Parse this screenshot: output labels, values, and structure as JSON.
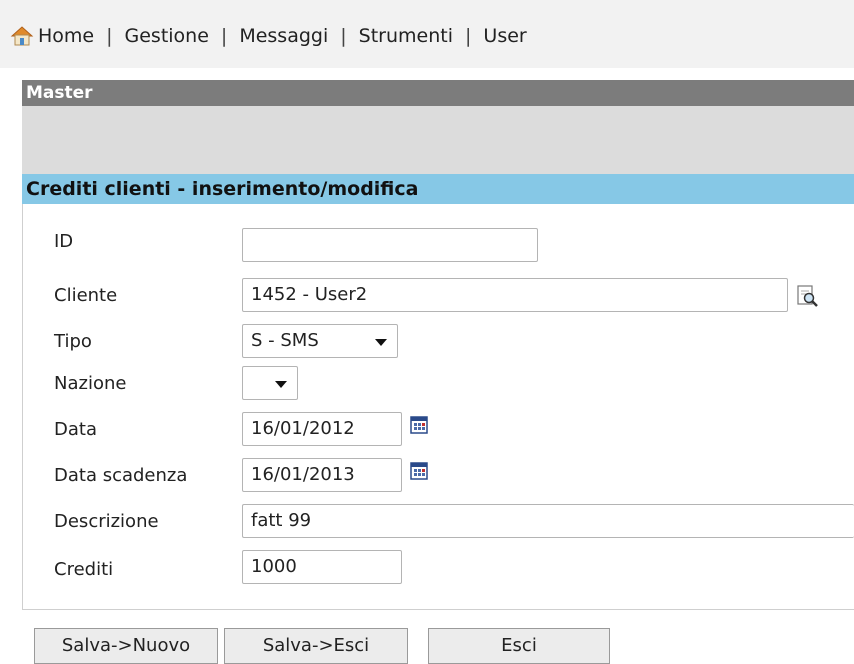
{
  "nav": {
    "items": [
      "Home",
      "Gestione",
      "Messaggi",
      "Strumenti",
      "User"
    ],
    "separator": "|"
  },
  "master": {
    "title": "Master"
  },
  "section": {
    "title": "Crediti clienti - inserimento/modifica"
  },
  "form": {
    "id": {
      "label": "ID",
      "value": ""
    },
    "cliente": {
      "label": "Cliente",
      "value": "1452 - User2"
    },
    "tipo": {
      "label": "Tipo",
      "value": "S - SMS"
    },
    "nazione": {
      "label": "Nazione",
      "value": ""
    },
    "data": {
      "label": "Data",
      "value": "16/01/2012"
    },
    "data_scadenza": {
      "label": "Data scadenza",
      "value": "16/01/2013"
    },
    "descrizione": {
      "label": "Descrizione",
      "value": "fatt 99"
    },
    "crediti": {
      "label": "Crediti",
      "value": "1000"
    }
  },
  "buttons": {
    "save_new": "Salva->Nuovo",
    "save_exit": "Salva->Esci",
    "exit": "Esci"
  },
  "icons": {
    "home": "home-icon",
    "lookup": "magnifier-document-icon",
    "calendar": "calendar-icon"
  },
  "colors": {
    "nav_bg": "#f2f2f2",
    "master_bar": "#7c7c7c",
    "grey_band": "#dcdcdc",
    "section_title": "#86c8e6"
  }
}
